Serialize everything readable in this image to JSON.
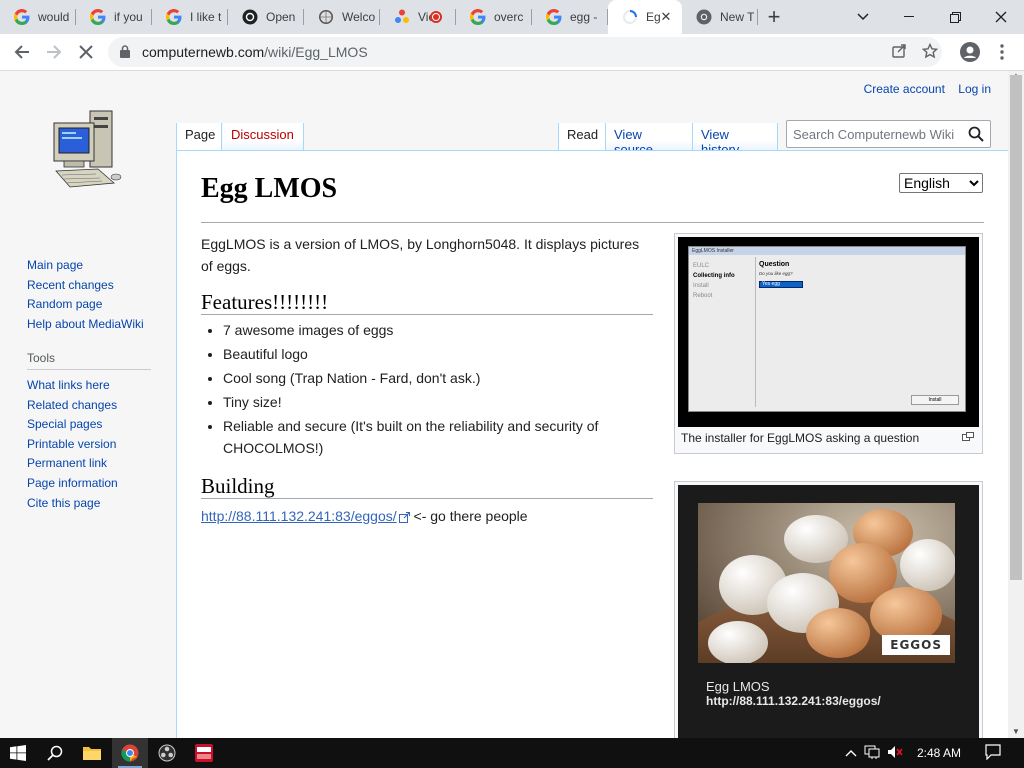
{
  "browser": {
    "tabs": [
      {
        "title": "would",
        "icon": "google-icon"
      },
      {
        "title": "if you",
        "icon": "google-icon"
      },
      {
        "title": "I like t",
        "icon": "google-icon"
      },
      {
        "title": "Open",
        "icon": "openai-icon"
      },
      {
        "title": "Welco",
        "icon": "wiki-icon"
      },
      {
        "title": "Vic",
        "icon": "recording-icon"
      },
      {
        "title": "overc",
        "icon": "google-icon"
      },
      {
        "title": "egg -",
        "icon": "google-icon"
      },
      {
        "title": "Eg",
        "icon": "loading-icon",
        "active": true
      },
      {
        "title": "New T",
        "icon": "chrome-icon"
      }
    ],
    "url_host": "computernewb.com",
    "url_path": "/wiki/Egg_LMOS"
  },
  "wiki": {
    "personal": {
      "create_account": "Create account",
      "log_in": "Log in"
    },
    "tabs": {
      "page": "Page",
      "discussion": "Discussion",
      "read": "Read",
      "view_source": "View source",
      "view_history": "View history"
    },
    "search_placeholder": "Search Computernewb Wiki",
    "nav": [
      "Main page",
      "Recent changes",
      "Random page",
      "Help about MediaWiki"
    ],
    "tools_heading": "Tools",
    "tools": [
      "What links here",
      "Related changes",
      "Special pages",
      "Printable version",
      "Permanent link",
      "Page information",
      "Cite this page"
    ],
    "title": "Egg LMOS",
    "language": "English",
    "intro": "EggLMOS is a version of LMOS, by Longhorn5048. It displays pictures of eggs.",
    "features_heading": "Features!!!!!!!!",
    "features": [
      "7 awesome images of eggs",
      "Beautiful logo",
      "Cool song (Trap Nation - Fard, don't ask.)",
      "Tiny size!",
      "Reliable and secure (It's built on the reliability and security of CHOCOLMOS!)"
    ],
    "building_heading": "Building",
    "building_link": "http://88.111.132.241:83/eggos/",
    "building_suffix": " <- go there people",
    "thumb1": {
      "caption": "The installer for EggLMOS asking a question",
      "installer_title": "EggLMOS Installer",
      "sidebar": [
        "EULC",
        "Collecting info",
        "Install",
        "Reboot"
      ],
      "question": "Question",
      "subtext": "Do you like egg?",
      "answer": "Yes egg",
      "button": "Install"
    },
    "thumb2": {
      "overlay": "EGGOS",
      "title": "Egg LMOS",
      "url": "http://88.111.132.241:83/eggos/"
    }
  },
  "taskbar": {
    "clock": "2:48 AM"
  }
}
